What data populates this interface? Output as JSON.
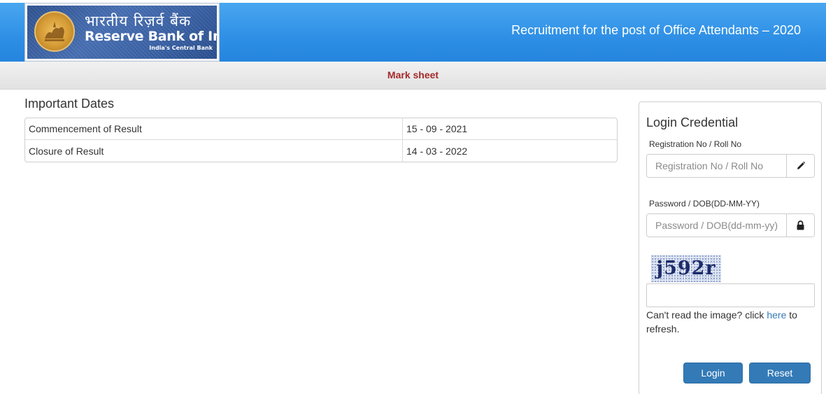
{
  "logo": {
    "hindi": "भारतीय रिज़र्व बैंक",
    "english": "Reserve Bank of India",
    "tagline": "India's Central Bank"
  },
  "header": {
    "title": "Recruitment for the post of Office Attendants – 2020",
    "bg_color": "#2e8fe5"
  },
  "subbar": {
    "label": "Mark sheet",
    "label_color": "#a52a2a"
  },
  "important_dates": {
    "title": "Important Dates",
    "rows": [
      {
        "event": "Commencement of Result",
        "date": "15 - 09 - 2021"
      },
      {
        "event": "Closure of Result",
        "date": "14 - 03 - 2022"
      }
    ]
  },
  "login": {
    "title": "Login Credential",
    "registration": {
      "label": "Registration No / Roll No",
      "placeholder": "Registration No / Roll No",
      "value": "",
      "icon": "pencil-icon"
    },
    "password": {
      "label": "Password / DOB(DD-MM-YY)",
      "placeholder": "Password / DOB(dd-mm-yy)",
      "value": "",
      "icon": "lock-icon"
    },
    "captcha": {
      "text": "j592r",
      "value": ""
    },
    "refresh": {
      "prefix": "Can't read the image? click ",
      "link": "here",
      "suffix": " to refresh."
    },
    "login_button": "Login",
    "reset_button": "Reset",
    "button_color": "#337ab7"
  }
}
